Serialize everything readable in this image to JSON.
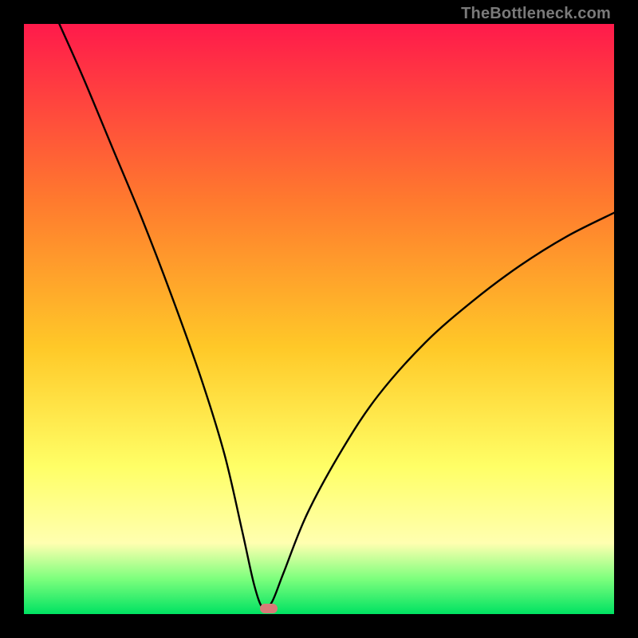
{
  "watermark": "TheBottleneck.com",
  "colors": {
    "top": "#ff1a4b",
    "mid_upper": "#ff7a2e",
    "mid": "#ffc928",
    "mid_lower": "#ffff66",
    "pale_band": "#ffffb0",
    "green_band": "#7dff7d",
    "bottom": "#00e262",
    "curve": "#000000",
    "marker": "#d87a78",
    "frame": "#000000"
  },
  "chart_data": {
    "type": "line",
    "title": "",
    "xlabel": "",
    "ylabel": "",
    "xlim": [
      0,
      100
    ],
    "ylim": [
      0,
      100
    ],
    "series": [
      {
        "name": "bottleneck-curve",
        "x_min": 40.5,
        "left_start": {
          "x": 6,
          "y": 100
        },
        "right_end": {
          "x": 100,
          "y": 68
        },
        "points": [
          {
            "x": 6,
            "y": 100
          },
          {
            "x": 10,
            "y": 91
          },
          {
            "x": 15,
            "y": 79
          },
          {
            "x": 20,
            "y": 67
          },
          {
            "x": 25,
            "y": 54
          },
          {
            "x": 30,
            "y": 40
          },
          {
            "x": 34,
            "y": 27
          },
          {
            "x": 37,
            "y": 14
          },
          {
            "x": 39,
            "y": 5
          },
          {
            "x": 40.5,
            "y": 1
          },
          {
            "x": 42,
            "y": 2
          },
          {
            "x": 44,
            "y": 7
          },
          {
            "x": 48,
            "y": 17
          },
          {
            "x": 54,
            "y": 28
          },
          {
            "x": 60,
            "y": 37
          },
          {
            "x": 68,
            "y": 46
          },
          {
            "x": 76,
            "y": 53
          },
          {
            "x": 84,
            "y": 59
          },
          {
            "x": 92,
            "y": 64
          },
          {
            "x": 100,
            "y": 68
          }
        ]
      }
    ],
    "marker": {
      "x": 41.5,
      "y": 1
    },
    "gradient_stops": [
      {
        "offset": 0,
        "color": "#ff1a4b"
      },
      {
        "offset": 0.3,
        "color": "#ff7a2e"
      },
      {
        "offset": 0.55,
        "color": "#ffc928"
      },
      {
        "offset": 0.75,
        "color": "#ffff66"
      },
      {
        "offset": 0.88,
        "color": "#ffffb0"
      },
      {
        "offset": 0.94,
        "color": "#7dff7d"
      },
      {
        "offset": 1.0,
        "color": "#00e262"
      }
    ]
  }
}
